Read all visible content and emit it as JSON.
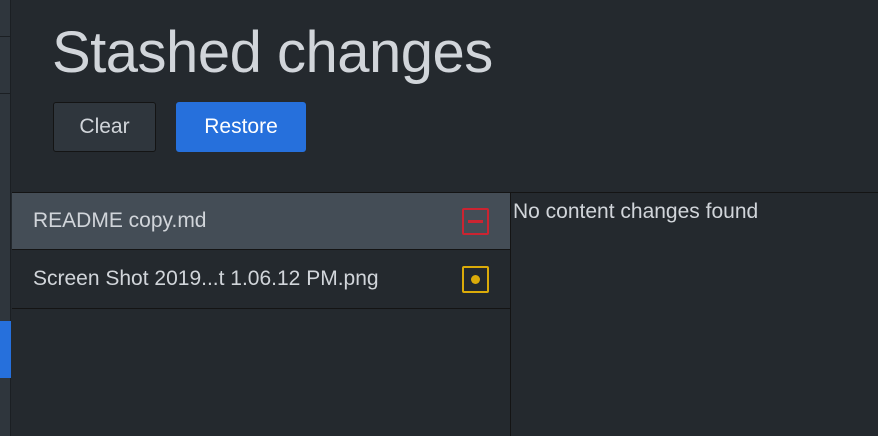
{
  "header": {
    "title": "Stashed changes",
    "clear_label": "Clear",
    "restore_label": "Restore"
  },
  "files": [
    {
      "name": "README copy.md",
      "status": "deleted",
      "selected": true
    },
    {
      "name": "Screen Shot 2019...t 1.06.12 PM.png",
      "status": "modified",
      "selected": false
    }
  ],
  "diff": {
    "message": "No content changes found"
  },
  "colors": {
    "background": "#24292e",
    "accent": "#2670dc",
    "deleted": "#cb2431",
    "modified": "#dbab09",
    "selected_row": "#444d56",
    "text": "#d1d5da"
  }
}
